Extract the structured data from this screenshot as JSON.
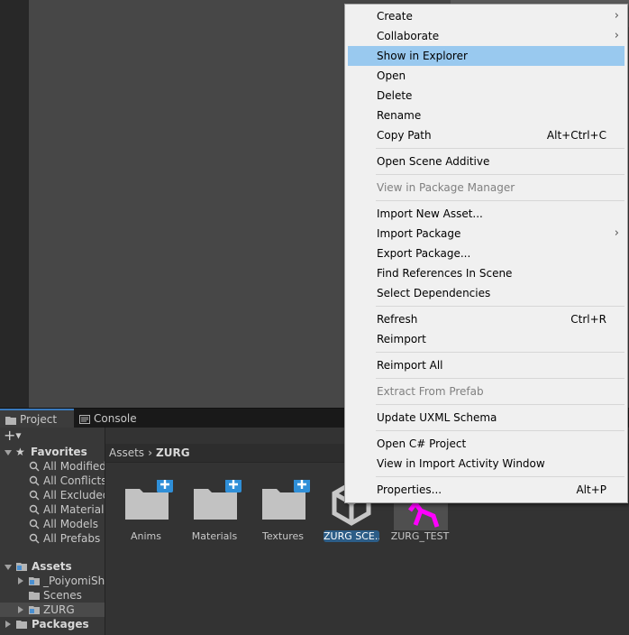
{
  "tabs": {
    "project": "Project",
    "console": "Console"
  },
  "favorites": {
    "title": "Favorites",
    "items": [
      "All Modified",
      "All Conflicts",
      "All Excluded",
      "All Materials",
      "All Models",
      "All Prefabs"
    ]
  },
  "assets_tree": {
    "title": "Assets",
    "children": [
      "_PoiyomiShaders",
      "Scenes",
      "ZURG"
    ],
    "packages": "Packages"
  },
  "breadcrumb": {
    "root": "Assets",
    "separator": "›",
    "current": "ZURG"
  },
  "assets_grid": [
    {
      "label": "Anims",
      "icon": "folder-add-icon"
    },
    {
      "label": "Materials",
      "icon": "folder-add-icon"
    },
    {
      "label": "Textures",
      "icon": "folder-add-icon"
    },
    {
      "label": "ZURG SCE...",
      "icon": "unity-scene-icon"
    },
    {
      "label": "ZURG_TEST",
      "icon": "animation-clip-icon"
    }
  ],
  "context_menu": {
    "items": [
      {
        "label": "Create",
        "submenu": true
      },
      {
        "label": "Collaborate",
        "submenu": true
      },
      {
        "label": "Show in Explorer",
        "highlighted": true
      },
      {
        "label": "Open"
      },
      {
        "label": "Delete"
      },
      {
        "label": "Rename"
      },
      {
        "label": "Copy Path",
        "shortcut": "Alt+Ctrl+C"
      },
      {
        "label": "Open Scene Additive"
      },
      {
        "label": "View in Package Manager",
        "disabled": true
      },
      {
        "label": "Import New Asset..."
      },
      {
        "label": "Import Package",
        "submenu": true
      },
      {
        "label": "Export Package..."
      },
      {
        "label": "Find References In Scene"
      },
      {
        "label": "Select Dependencies"
      },
      {
        "label": "Refresh",
        "shortcut": "Ctrl+R"
      },
      {
        "label": "Reimport"
      },
      {
        "label": "Reimport All"
      },
      {
        "label": "Extract From Prefab",
        "disabled": true
      },
      {
        "label": "Update UXML Schema"
      },
      {
        "label": "Open C# Project"
      },
      {
        "label": "View in Import Activity Window"
      },
      {
        "label": "Properties...",
        "shortcut": "Alt+P"
      }
    ]
  },
  "colors": {
    "menu_highlight": "#99c9ef",
    "selection_blue": "#2c5d87",
    "tab_accent": "#3a79bb",
    "anim_magenta": "#ff00ff"
  }
}
